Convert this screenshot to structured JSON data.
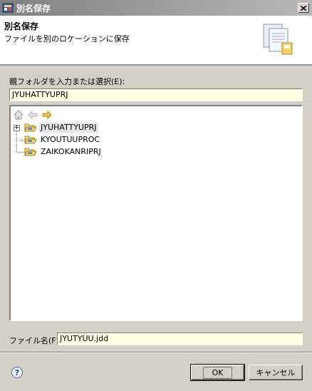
{
  "window": {
    "title": "別名保存"
  },
  "header": {
    "title": "別名保存",
    "subtitle": "ファイルを別のロケーションに保存"
  },
  "parent_folder": {
    "label": "親フォルダを入力または選択(E):",
    "value": "JYUHATTYUPRJ"
  },
  "tree": {
    "items": [
      {
        "label": "JYUHATTYUPRJ",
        "selected": true,
        "expandable": true
      },
      {
        "label": "KYOUTUUPROC",
        "selected": false,
        "expandable": false
      },
      {
        "label": "ZAIKOKANRIPRJ",
        "selected": false,
        "expandable": false
      }
    ]
  },
  "file_name": {
    "label": "ファイル名(F):",
    "value": "JYUTYUU.jdd"
  },
  "buttons": {
    "ok": "OK",
    "cancel": "キャンセル"
  },
  "colors": {
    "input_bg": "#ffffe1",
    "dialog_bg": "#d4d0c8",
    "folder_yellow": "#f2d36b",
    "nav_arrow": "#e8b830"
  },
  "icons": {
    "home": "home-icon",
    "back": "back-arrow-icon",
    "forward": "forward-arrow-icon",
    "help": "help-icon"
  }
}
